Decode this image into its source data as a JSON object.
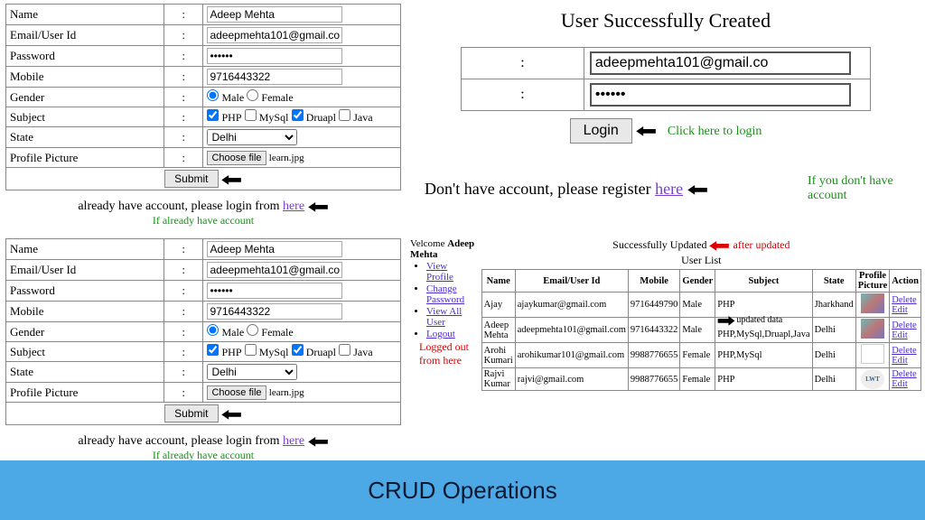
{
  "form": {
    "labels": {
      "name": "Name",
      "email": "Email/User Id",
      "password": "Password",
      "mobile": "Mobile",
      "gender": "Gender",
      "subject": "Subject",
      "state": "State",
      "picture": "Profile Picture"
    },
    "values": {
      "name": "Adeep Mehta",
      "email": "adeepmehta101@gmail.co",
      "password": "••••••",
      "mobile": "9716443322",
      "state": "Delhi",
      "filename": "learn.jpg"
    },
    "gender": {
      "male": "Male",
      "female": "Female"
    },
    "subjects": {
      "php": "PHP",
      "mysql": "MySql",
      "drupal": "Druapl",
      "java": "Java"
    },
    "choose_file": "Choose file",
    "submit": "Submit",
    "login_hint_prefix": "already have account, please login from ",
    "login_hint_link": "here",
    "green_note": "If already have account",
    "colon": ":"
  },
  "success": {
    "title": "User Successfully Created",
    "colon": ":",
    "email": "adeepmehta101@gmail.co",
    "password": "••••••",
    "login_btn": "Login",
    "click_here": "Click here to login",
    "register_prefix": "Don't have account, please register ",
    "register_link": "here",
    "register_green": "If you don't have account"
  },
  "dashboard": {
    "welcome_prefix": "Velcome ",
    "welcome_name": "Adeep Mehta",
    "nav": {
      "view_profile": "View Profile",
      "change_password": "Change Password",
      "view_all": "View All User",
      "logout": "Logout"
    },
    "logged_out_note": "Logged out from here",
    "updated_msg": "Successfully Updated",
    "after_updated": "after updated",
    "updated_data": "updated data",
    "list_title": "User List",
    "headers": {
      "name": "Name",
      "email": "Email/User Id",
      "mobile": "Mobile",
      "gender": "Gender",
      "subject": "Subject",
      "state": "State",
      "picture": "Profile Picture",
      "action": "Action"
    },
    "rows": [
      {
        "name": "Ajay",
        "email": "ajaykumar@gmail.com",
        "mobile": "9716449790",
        "gender": "Male",
        "subject": "PHP",
        "state": "Jharkhand"
      },
      {
        "name": "Adeep Mehta",
        "email": "adeepmehta101@gmail.com",
        "mobile": "9716443322",
        "gender": "Male",
        "subject": "PHP,MySql,Druapl,Java",
        "state": "Delhi"
      },
      {
        "name": "Arohi Kumari",
        "email": "arohikumar101@gmail.com",
        "mobile": "9988776655",
        "gender": "Female",
        "subject": "PHP,MySql",
        "state": "Delhi"
      },
      {
        "name": "Rajvi Kumar",
        "email": "rajvi@gmail.com",
        "mobile": "9988776655",
        "gender": "Female",
        "subject": "PHP",
        "state": "Delhi"
      }
    ],
    "action": {
      "delete": "Delete",
      "edit": "Edit"
    }
  },
  "footer": {
    "title": "CRUD Operations"
  }
}
